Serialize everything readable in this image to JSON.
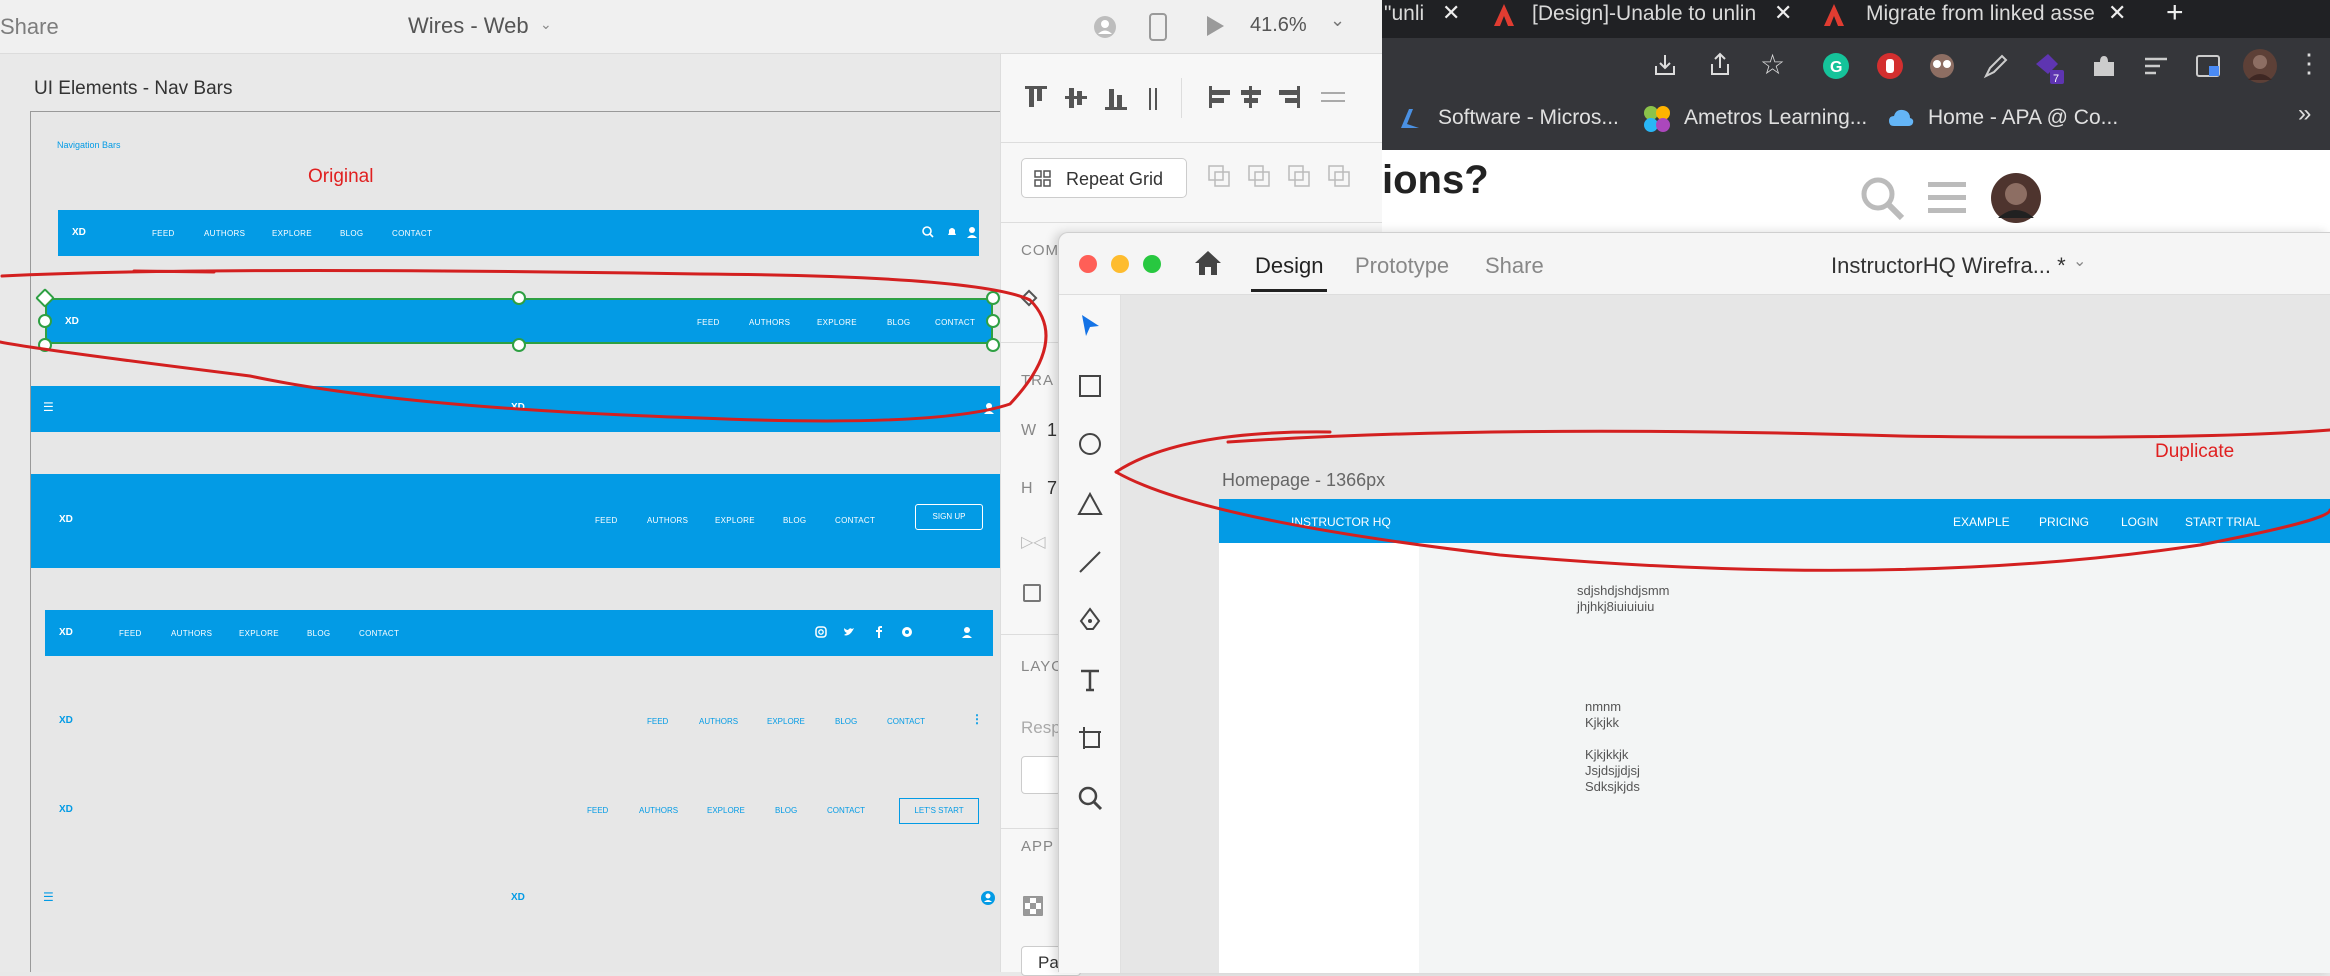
{
  "left_window": {
    "share": "Share",
    "doc_title": "Wires - Web",
    "zoom": "41.6%",
    "artboard_title": "UI Elements - Nav Bars",
    "section_label": "Navigation Bars",
    "annotation": "Original",
    "nav_logo": "XD",
    "nav_links": [
      "FEED",
      "AUTHORS",
      "EXPLORE",
      "BLOG",
      "CONTACT"
    ],
    "signup": "SIGN UP",
    "lets_start": "LET'S START",
    "panel": {
      "repeat_grid": "Repeat Grid",
      "component": "COMP",
      "transform": "TRA",
      "w_label": "W",
      "w_val": "1",
      "h_label": "H",
      "h_val": "7",
      "layout": "LAYO",
      "responsive": "Resp",
      "appearance": "APP",
      "pa": "Pa"
    }
  },
  "browser": {
    "tabs": [
      "\"unli",
      "[Design]-Unable to unlin",
      "Migrate from linked asse"
    ],
    "bookmarks": [
      "Software - Micros...",
      "Ametros Learning...",
      "Home - APA @ Co..."
    ],
    "extension_badge": "7",
    "page_heading": "ions?"
  },
  "right_window": {
    "tabs": [
      "Design",
      "Prototype",
      "Share"
    ],
    "doc_title": "InstructorHQ Wirefra... *",
    "annotation": "Duplicate",
    "artboard_title": "Homepage - 1366px",
    "nav_logo": "INSTRUCTOR HQ",
    "nav_links": [
      "EXAMPLE",
      "PRICING",
      "LOGIN",
      "START TRIAL"
    ],
    "body_text_1": [
      "sdjshdjshdjsmm",
      "jhjhkj8iuiuiuiu"
    ],
    "body_text_2": [
      "nmnm",
      "Kjkjkk",
      "",
      "Kjkjkkjk",
      "Jsjdsjjdjsj",
      "Sdksjkjds"
    ]
  },
  "colors": {
    "accent": "#039be5",
    "annotation": "#e02020",
    "selection": "#2ea043"
  }
}
